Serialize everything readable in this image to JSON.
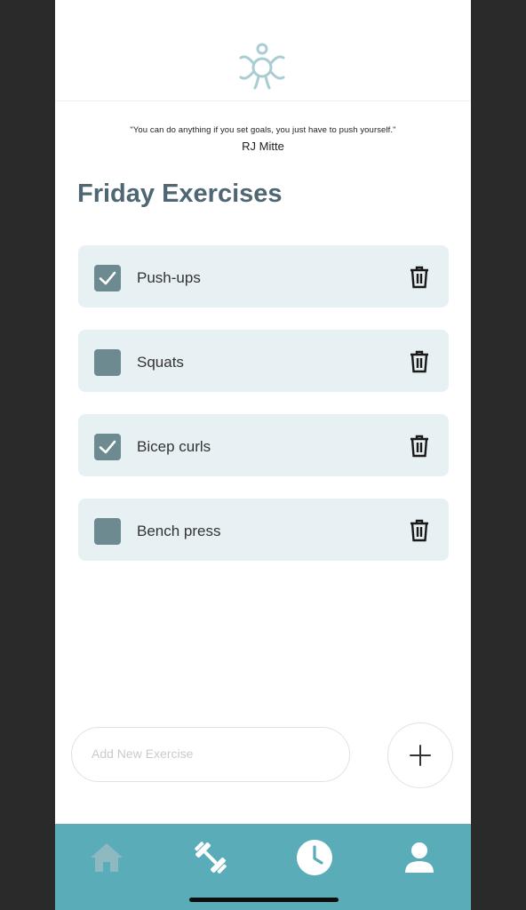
{
  "quote": {
    "text": "\"You can do anything if you set goals, you just have to push yourself.\"",
    "author": "RJ Mitte"
  },
  "page": {
    "title": "Friday Exercises"
  },
  "exercises": [
    {
      "label": "Push-ups",
      "checked": true
    },
    {
      "label": "Squats",
      "checked": false
    },
    {
      "label": "Bicep curls",
      "checked": true
    },
    {
      "label": "Bench press",
      "checked": false
    }
  ],
  "add_exercise": {
    "placeholder": "Add New Exercise"
  },
  "nav": {
    "items": [
      "home-icon",
      "dumbbell-icon",
      "clock-icon",
      "user-icon"
    ]
  },
  "colors": {
    "accent": "#5aadb8",
    "card": "#e7f1f3",
    "checkbox": "#6c8a8f",
    "title": "#4f6673"
  }
}
